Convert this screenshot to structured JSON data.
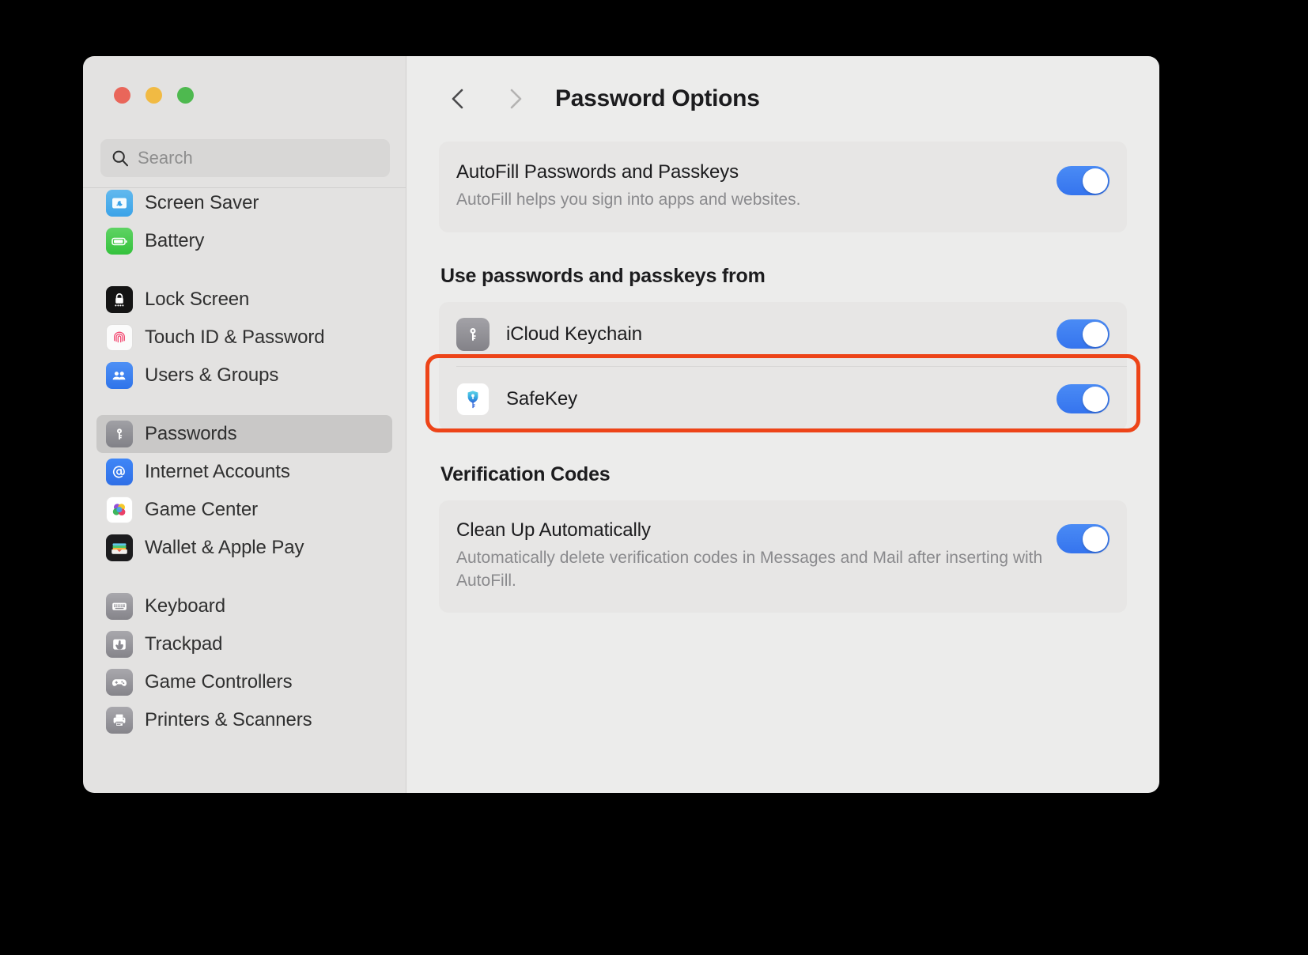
{
  "window": {
    "traffic_lights": [
      {
        "name": "close",
        "color": "#e9665a"
      },
      {
        "name": "minimize",
        "color": "#f1ba43"
      },
      {
        "name": "maximize",
        "color": "#4eb94f"
      }
    ]
  },
  "sidebar": {
    "search": {
      "placeholder": "Search",
      "value": "",
      "icon": "search-icon"
    },
    "groups": [
      {
        "items": [
          {
            "label": "Screen Saver",
            "icon": "screen-saver-icon",
            "selected": false
          },
          {
            "label": "Battery",
            "icon": "battery-icon",
            "selected": false
          }
        ]
      },
      {
        "items": [
          {
            "label": "Lock Screen",
            "icon": "lock-screen-icon",
            "selected": false
          },
          {
            "label": "Touch ID & Password",
            "icon": "touch-id-icon",
            "selected": false
          },
          {
            "label": "Users & Groups",
            "icon": "users-groups-icon",
            "selected": false
          }
        ]
      },
      {
        "items": [
          {
            "label": "Passwords",
            "icon": "passwords-key-icon",
            "selected": true
          },
          {
            "label": "Internet Accounts",
            "icon": "internet-accounts-icon",
            "selected": false
          },
          {
            "label": "Game Center",
            "icon": "game-center-icon",
            "selected": false
          },
          {
            "label": "Wallet & Apple Pay",
            "icon": "wallet-icon",
            "selected": false
          }
        ]
      },
      {
        "items": [
          {
            "label": "Keyboard",
            "icon": "keyboard-icon",
            "selected": false
          },
          {
            "label": "Trackpad",
            "icon": "trackpad-icon",
            "selected": false
          },
          {
            "label": "Game Controllers",
            "icon": "game-controller-icon",
            "selected": false
          },
          {
            "label": "Printers & Scanners",
            "icon": "printer-icon",
            "selected": false
          }
        ]
      }
    ]
  },
  "main": {
    "header": {
      "back_icon": "chevron-left-icon",
      "forward_icon": "chevron-right-icon",
      "title": "Password Options"
    },
    "autofill": {
      "title": "AutoFill Passwords and Passkeys",
      "subtitle": "AutoFill helps you sign into apps and websites.",
      "toggle_state": "on"
    },
    "sources_section": {
      "heading": "Use passwords and passkeys from",
      "rows": [
        {
          "label": "iCloud Keychain",
          "icon": "icloud-keychain-icon",
          "toggle_state": "on"
        },
        {
          "label": "SafeKey",
          "icon": "safekey-shield-icon",
          "toggle_state": "on"
        }
      ]
    },
    "verification_section": {
      "heading": "Verification Codes",
      "row": {
        "title": "Clean Up Automatically",
        "subtitle": "Automatically delete verification codes in Messages and Mail after inserting with AutoFill.",
        "toggle_state": "on"
      }
    }
  },
  "annotation": {
    "highlight_color": "#ed4418",
    "target": "SafeKey"
  }
}
